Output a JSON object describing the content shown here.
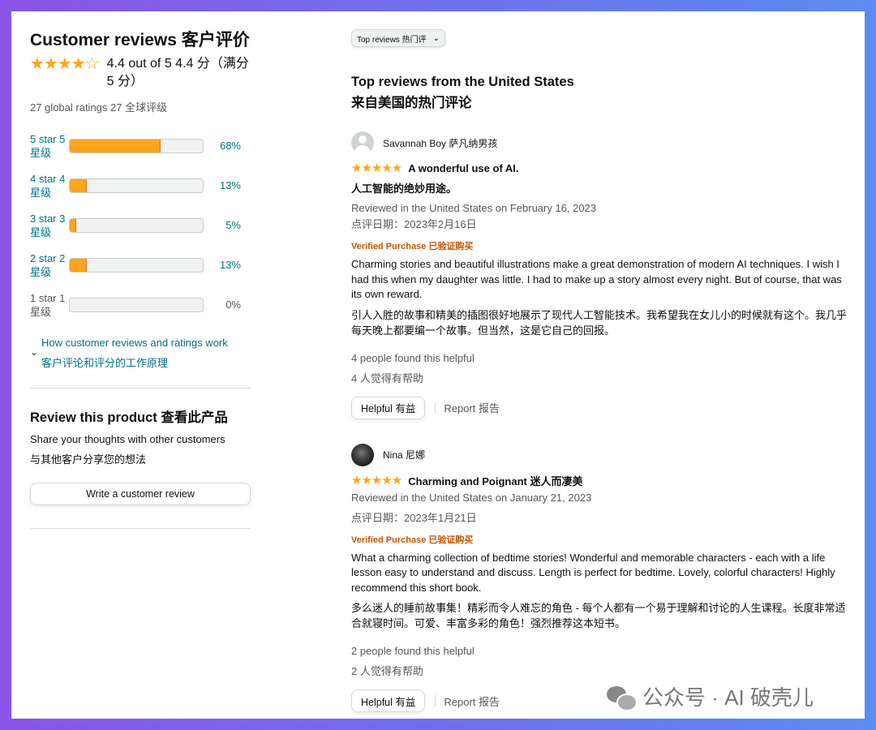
{
  "left": {
    "title": "Customer reviews 客户评价",
    "avg_stars": "★★★★☆",
    "avg_text": "4.4 out of 5 4.4 分（满分 5 分）",
    "global_ratings": "27 global ratings 27 全球评级",
    "histogram": [
      {
        "label": "5 star 5 星级",
        "pct_text": "68%",
        "pct": 68
      },
      {
        "label": "4 star 4 星级",
        "pct_text": "13%",
        "pct": 13
      },
      {
        "label": "3 star 3 星级",
        "pct_text": "5%",
        "pct": 5
      },
      {
        "label": "2 star 2 星级",
        "pct_text": "13%",
        "pct": 13
      },
      {
        "label": "1 star 1 星级",
        "pct_text": "0%",
        "pct": 0
      }
    ],
    "how_link_en": "How customer reviews and ratings work",
    "how_link_cn": "客户评论和评分的工作原理",
    "review_product_title": "Review this product 查看此产品",
    "share_en": "Share your thoughts with other customers",
    "share_cn": "与其他客户分享您的想法",
    "write_button": "Write a customer review"
  },
  "right": {
    "sort_label": "Top reviews 热门评",
    "section_title_en": "Top reviews from the United States",
    "section_title_cn": "来自美国的热门评论",
    "reviews": [
      {
        "name": "Savannah Boy 萨凡纳男孩",
        "stars": "★★★★★",
        "title": "A wonderful use of AI.",
        "title_cn": "人工智能的绝妙用途。",
        "reviewed_en": "Reviewed in the United States on February 16, 2023",
        "reviewed_cn": "点评日期：2023年2月16日",
        "verified": "Verified Purchase 已验证购买",
        "body_en": "Charming stories and beautiful illustrations make a great demonstration of modern AI techniques. I wish I had this when my daughter was little. I had to make up a story almost every night. But of course, that was its own reward.",
        "body_cn": "引人入胜的故事和精美的插图很好地展示了现代人工智能技术。我希望我在女儿小的时候就有这个。我几乎每天晚上都要编一个故事。但当然，这是它自己的回报。",
        "helpful_en": "4 people found this helpful",
        "helpful_cn": "4 人觉得有帮助",
        "helpful_button": "Helpful 有益",
        "report": "Report 报告"
      },
      {
        "name": "Nina 尼娜",
        "stars": "★★★★★",
        "title": "Charming and Poignant 迷人而凄美",
        "reviewed_en": "Reviewed in the United States on January 21, 2023",
        "reviewed_cn": "点评日期：2023年1月21日",
        "verified": "Verified Purchase 已验证购买",
        "body_en": "What a charming collection of bedtime stories! Wonderful and memorable characters - each with a life lesson easy to understand and discuss. Length is perfect for bedtime. Lovely, colorful characters! Highly recommend this short book.",
        "body_cn": "多么迷人的睡前故事集！精彩而令人难忘的角色 - 每个人都有一个易于理解和讨论的人生课程。长度非常适合就寝时间。可爱、丰富多彩的角色！强烈推荐这本短书。",
        "helpful_en": "2 people found this helpful",
        "helpful_cn": "2 人觉得有帮助",
        "helpful_button": "Helpful 有益",
        "report": "Report 报告"
      }
    ]
  },
  "watermark": "公众号 · AI 破壳儿",
  "colors": {
    "star": "#ffa41c",
    "link": "#007185",
    "verified": "#c45500"
  }
}
